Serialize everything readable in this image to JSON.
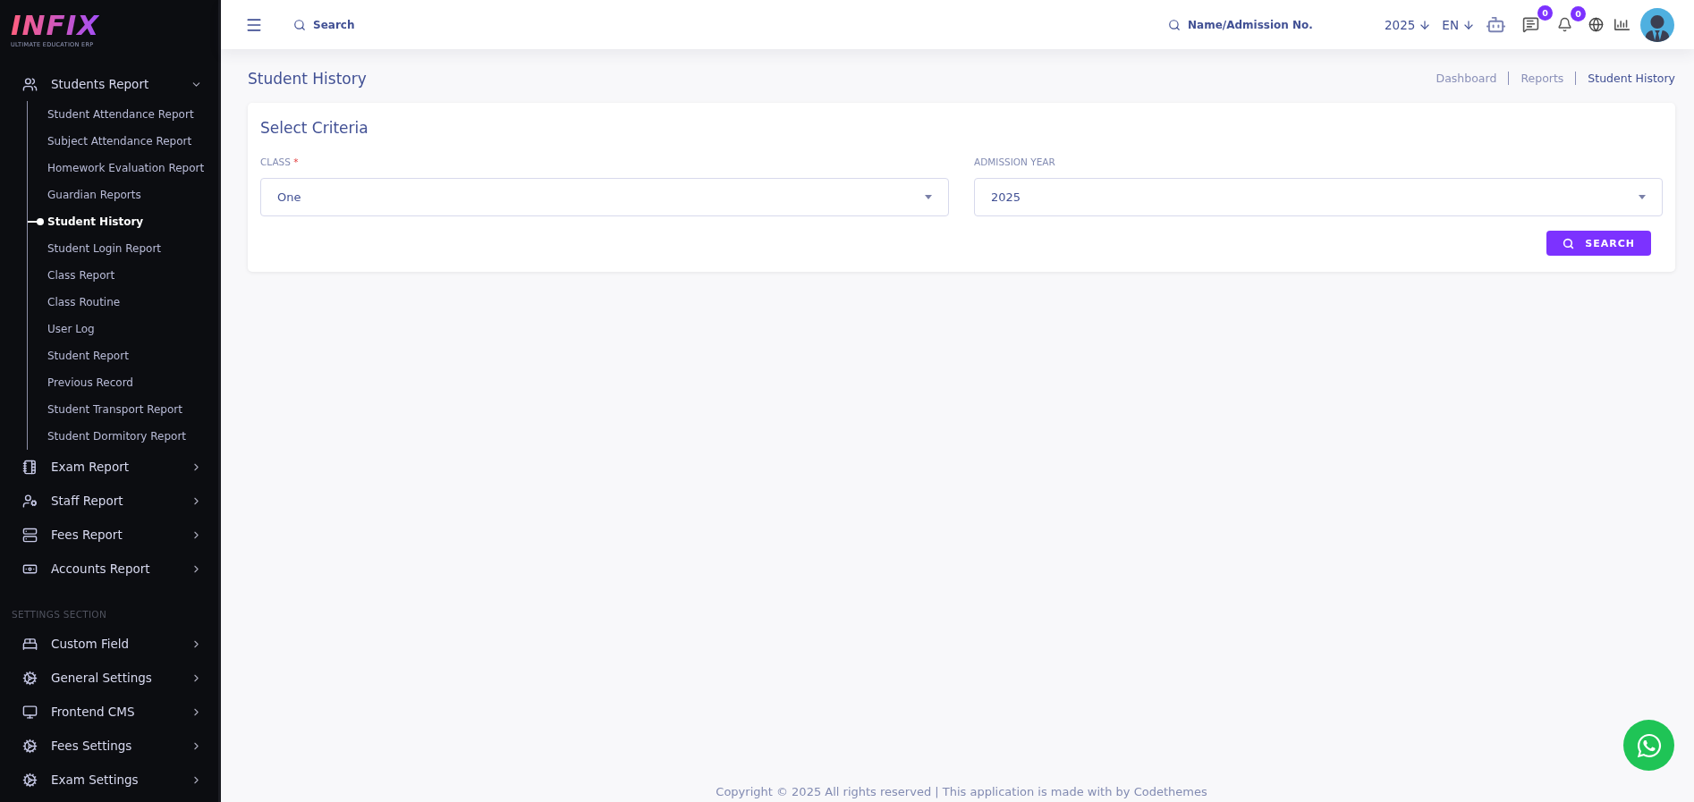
{
  "logo": {
    "text": "INFIX",
    "tagline": "ULTIMATE EDUCATION ERP"
  },
  "sidebar": {
    "groups": [
      {
        "label": "Students Report",
        "expanded": true,
        "children": [
          {
            "label": "Student Attendance Report",
            "selected": false
          },
          {
            "label": "Subject Attendance Report",
            "selected": false
          },
          {
            "label": "Homework Evaluation Report",
            "selected": false
          },
          {
            "label": "Guardian Reports",
            "selected": false
          },
          {
            "label": "Student History",
            "selected": true
          },
          {
            "label": "Student Login Report",
            "selected": false
          },
          {
            "label": "Class Report",
            "selected": false
          },
          {
            "label": "Class Routine",
            "selected": false
          },
          {
            "label": "User Log",
            "selected": false
          },
          {
            "label": "Student Report",
            "selected": false
          },
          {
            "label": "Previous Record",
            "selected": false
          },
          {
            "label": "Student Transport Report",
            "selected": false
          },
          {
            "label": "Student Dormitory Report",
            "selected": false
          }
        ]
      },
      {
        "label": "Exam Report",
        "expanded": false
      },
      {
        "label": "Staff Report",
        "expanded": false
      },
      {
        "label": "Fees Report",
        "expanded": false
      },
      {
        "label": "Accounts Report",
        "expanded": false
      }
    ],
    "section_title": "SETTINGS SECTION",
    "settings": [
      {
        "label": "Custom Field",
        "expanded": false
      },
      {
        "label": "General Settings",
        "expanded": false
      },
      {
        "label": "Frontend CMS",
        "expanded": false
      },
      {
        "label": "Fees Settings",
        "expanded": false
      },
      {
        "label": "Exam Settings",
        "expanded": false
      }
    ]
  },
  "topbar": {
    "search": {
      "placeholder": "Search"
    },
    "student_search": {
      "placeholder": "Name/Admission No."
    },
    "year": "2025",
    "language": "EN",
    "message_count": "0",
    "notification_count": "0"
  },
  "page": {
    "title": "Student History",
    "breadcrumbs": [
      {
        "label": "Dashboard",
        "current": false
      },
      {
        "label": "Reports",
        "current": false
      },
      {
        "label": "Student History",
        "current": true
      }
    ]
  },
  "criteria": {
    "title": "Select Criteria",
    "fields": [
      {
        "label": "CLASS",
        "required_mark": "*",
        "value": "One"
      },
      {
        "label": "ADMISSION YEAR",
        "value": "2025"
      }
    ],
    "button": "SEARCH"
  },
  "footer": "Copyright © 2025 All rights reserved | This application is made with by Codethemes"
}
